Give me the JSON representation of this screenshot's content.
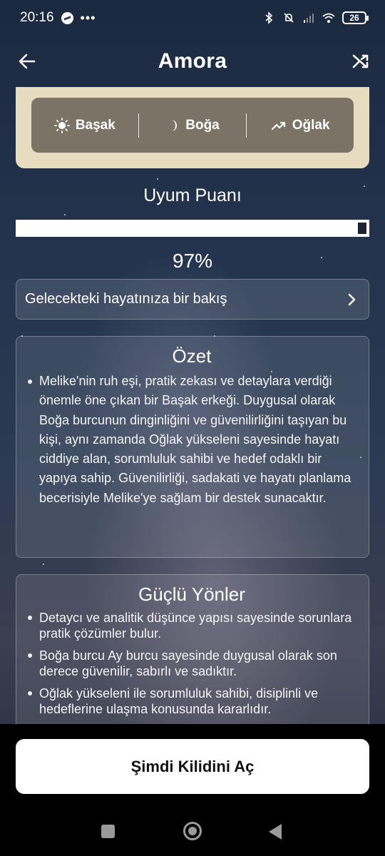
{
  "status_bar": {
    "time": "20:16",
    "battery": "26"
  },
  "header": {
    "title": "Amora"
  },
  "signs": {
    "sun": "Başak",
    "moon": "Boğa",
    "rising": "Oğlak"
  },
  "score": {
    "title": "Uyum Puanı",
    "value_text": "97%",
    "percent": 97
  },
  "future": {
    "label": "Gelecekteki hayatınıza bir bakış"
  },
  "summary": {
    "title": "Özet",
    "items": [
      "Melike'nin ruh eşi, pratik zekası ve detaylara verdiği önemle öne çıkan bir Başak erkeği. Duygusal olarak Boğa burcunun dinginliğini ve güvenilirliğini taşıyan bu kişi, aynı zamanda Oğlak yükseleni sayesinde hayatı ciddiye alan, sorumluluk sahibi ve hedef odaklı bir yapıya sahip. Güvenilirliği, sadakati ve hayatı planlama becerisiyle Melike'ye sağlam bir destek sunacaktır."
    ]
  },
  "strengths": {
    "title": "Güçlü Yönler",
    "items": [
      "Detaycı ve analitik düşünce yapısı sayesinde sorunlara pratik çözümler bulur.",
      "Boğa burcu Ay burcu sayesinde duygusal olarak son derece güvenilir, sabırlı ve sadıktır.",
      "Oğlak yükseleni ile sorumluluk sahibi, disiplinli ve hedeflerine ulaşma konusunda kararlıdır."
    ]
  },
  "cta": {
    "label": "Şimdi Kilidini Aç"
  }
}
